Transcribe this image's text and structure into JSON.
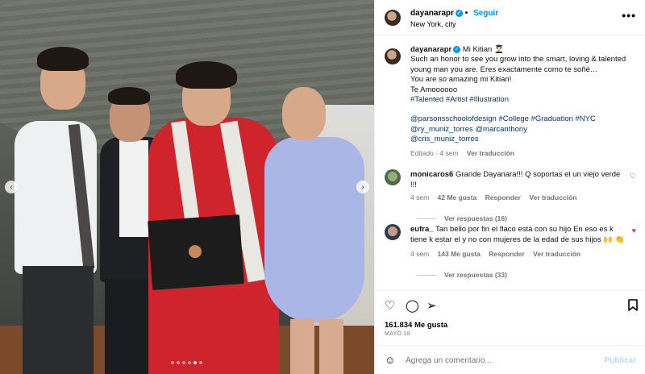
{
  "post": {
    "username": "dayanarapr",
    "follow_label": "Seguir",
    "location": "New York, city",
    "more_label": "•••"
  },
  "caption": {
    "username": "dayanarapr",
    "title": "Mi Kitian 👨🏻‍🎓",
    "lines": [
      "Such an honor to see you grow into the smart, loving & talented",
      "young man you are. Eres exactamente como te soñé…",
      "You are so amazing mi Kitian!",
      "Te Amoooooo"
    ],
    "hashtags": "#Talented #Artist #Illustration",
    "mentions": [
      "@parsonsschoolofdesign #College #Graduation #NYC",
      "@ry_muniz_torres @marcanthony",
      "@cris_muniz_torres"
    ],
    "meta": "Editado · 4 sem",
    "translate": "Ver traducción"
  },
  "comments": [
    {
      "username": "monicaros6",
      "text": "Grande Dayanara!!! Q soportas el un viejo verde !!!",
      "age": "4 sem",
      "likes": "42 Me gusta",
      "reply": "Responder",
      "translate": "Ver traducción",
      "replies": "Ver respuestas (16)",
      "liked": false
    },
    {
      "username": "eufra_",
      "text": "Tan bello por fin el flaco está con su hijo En eso es k tiene k estar el y no con mujeres de la edad de sus hijos 🙌 👏",
      "age": "4 sem",
      "likes": "143 Me gusta",
      "reply": "Responder",
      "translate": "Ver traducción",
      "replies": "Ver respuestas (33)",
      "liked": true
    }
  ],
  "stats": {
    "likes": "161.834 Me gusta",
    "date": "MAYO 18"
  },
  "composer": {
    "placeholder": "Agrega un comentario...",
    "post_label": "Publicar"
  },
  "carousel": {
    "slides": 6,
    "active": 4
  },
  "colors": {
    "accent": "#0095f6",
    "link": "#00376b",
    "muted": "#737373",
    "like_red": "#ff3040"
  }
}
